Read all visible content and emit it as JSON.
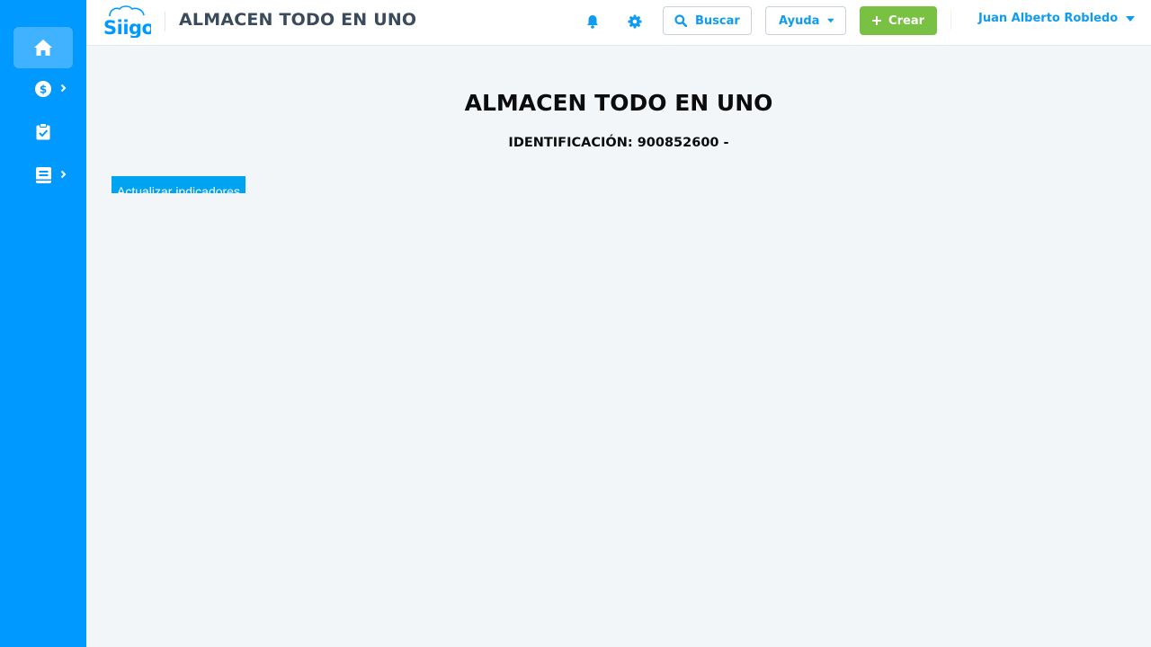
{
  "brand": {
    "logo_text": "Siigo",
    "accent": "#0099ff",
    "green": "#79c142"
  },
  "sidebar": {
    "items": [
      {
        "name": "home",
        "icon": "home-icon",
        "active": true
      },
      {
        "name": "finance",
        "icon": "dollar-circle-icon",
        "expandable": true
      },
      {
        "name": "tasks",
        "icon": "clipboard-check-icon"
      },
      {
        "name": "reports",
        "icon": "book-icon",
        "expandable": true
      }
    ]
  },
  "header": {
    "company_name": "ALMACEN TODO EN UNO",
    "search_label": "Buscar",
    "help_label": "Ayuda",
    "create_label": "Crear",
    "user_name": "Juan Alberto Robledo"
  },
  "main": {
    "title": "ALMACEN TODO EN UNO",
    "id_label": "IDENTIFICACIÓN:",
    "id_value": "900852600 -",
    "update_button_label": "Actualizar indicadores"
  }
}
